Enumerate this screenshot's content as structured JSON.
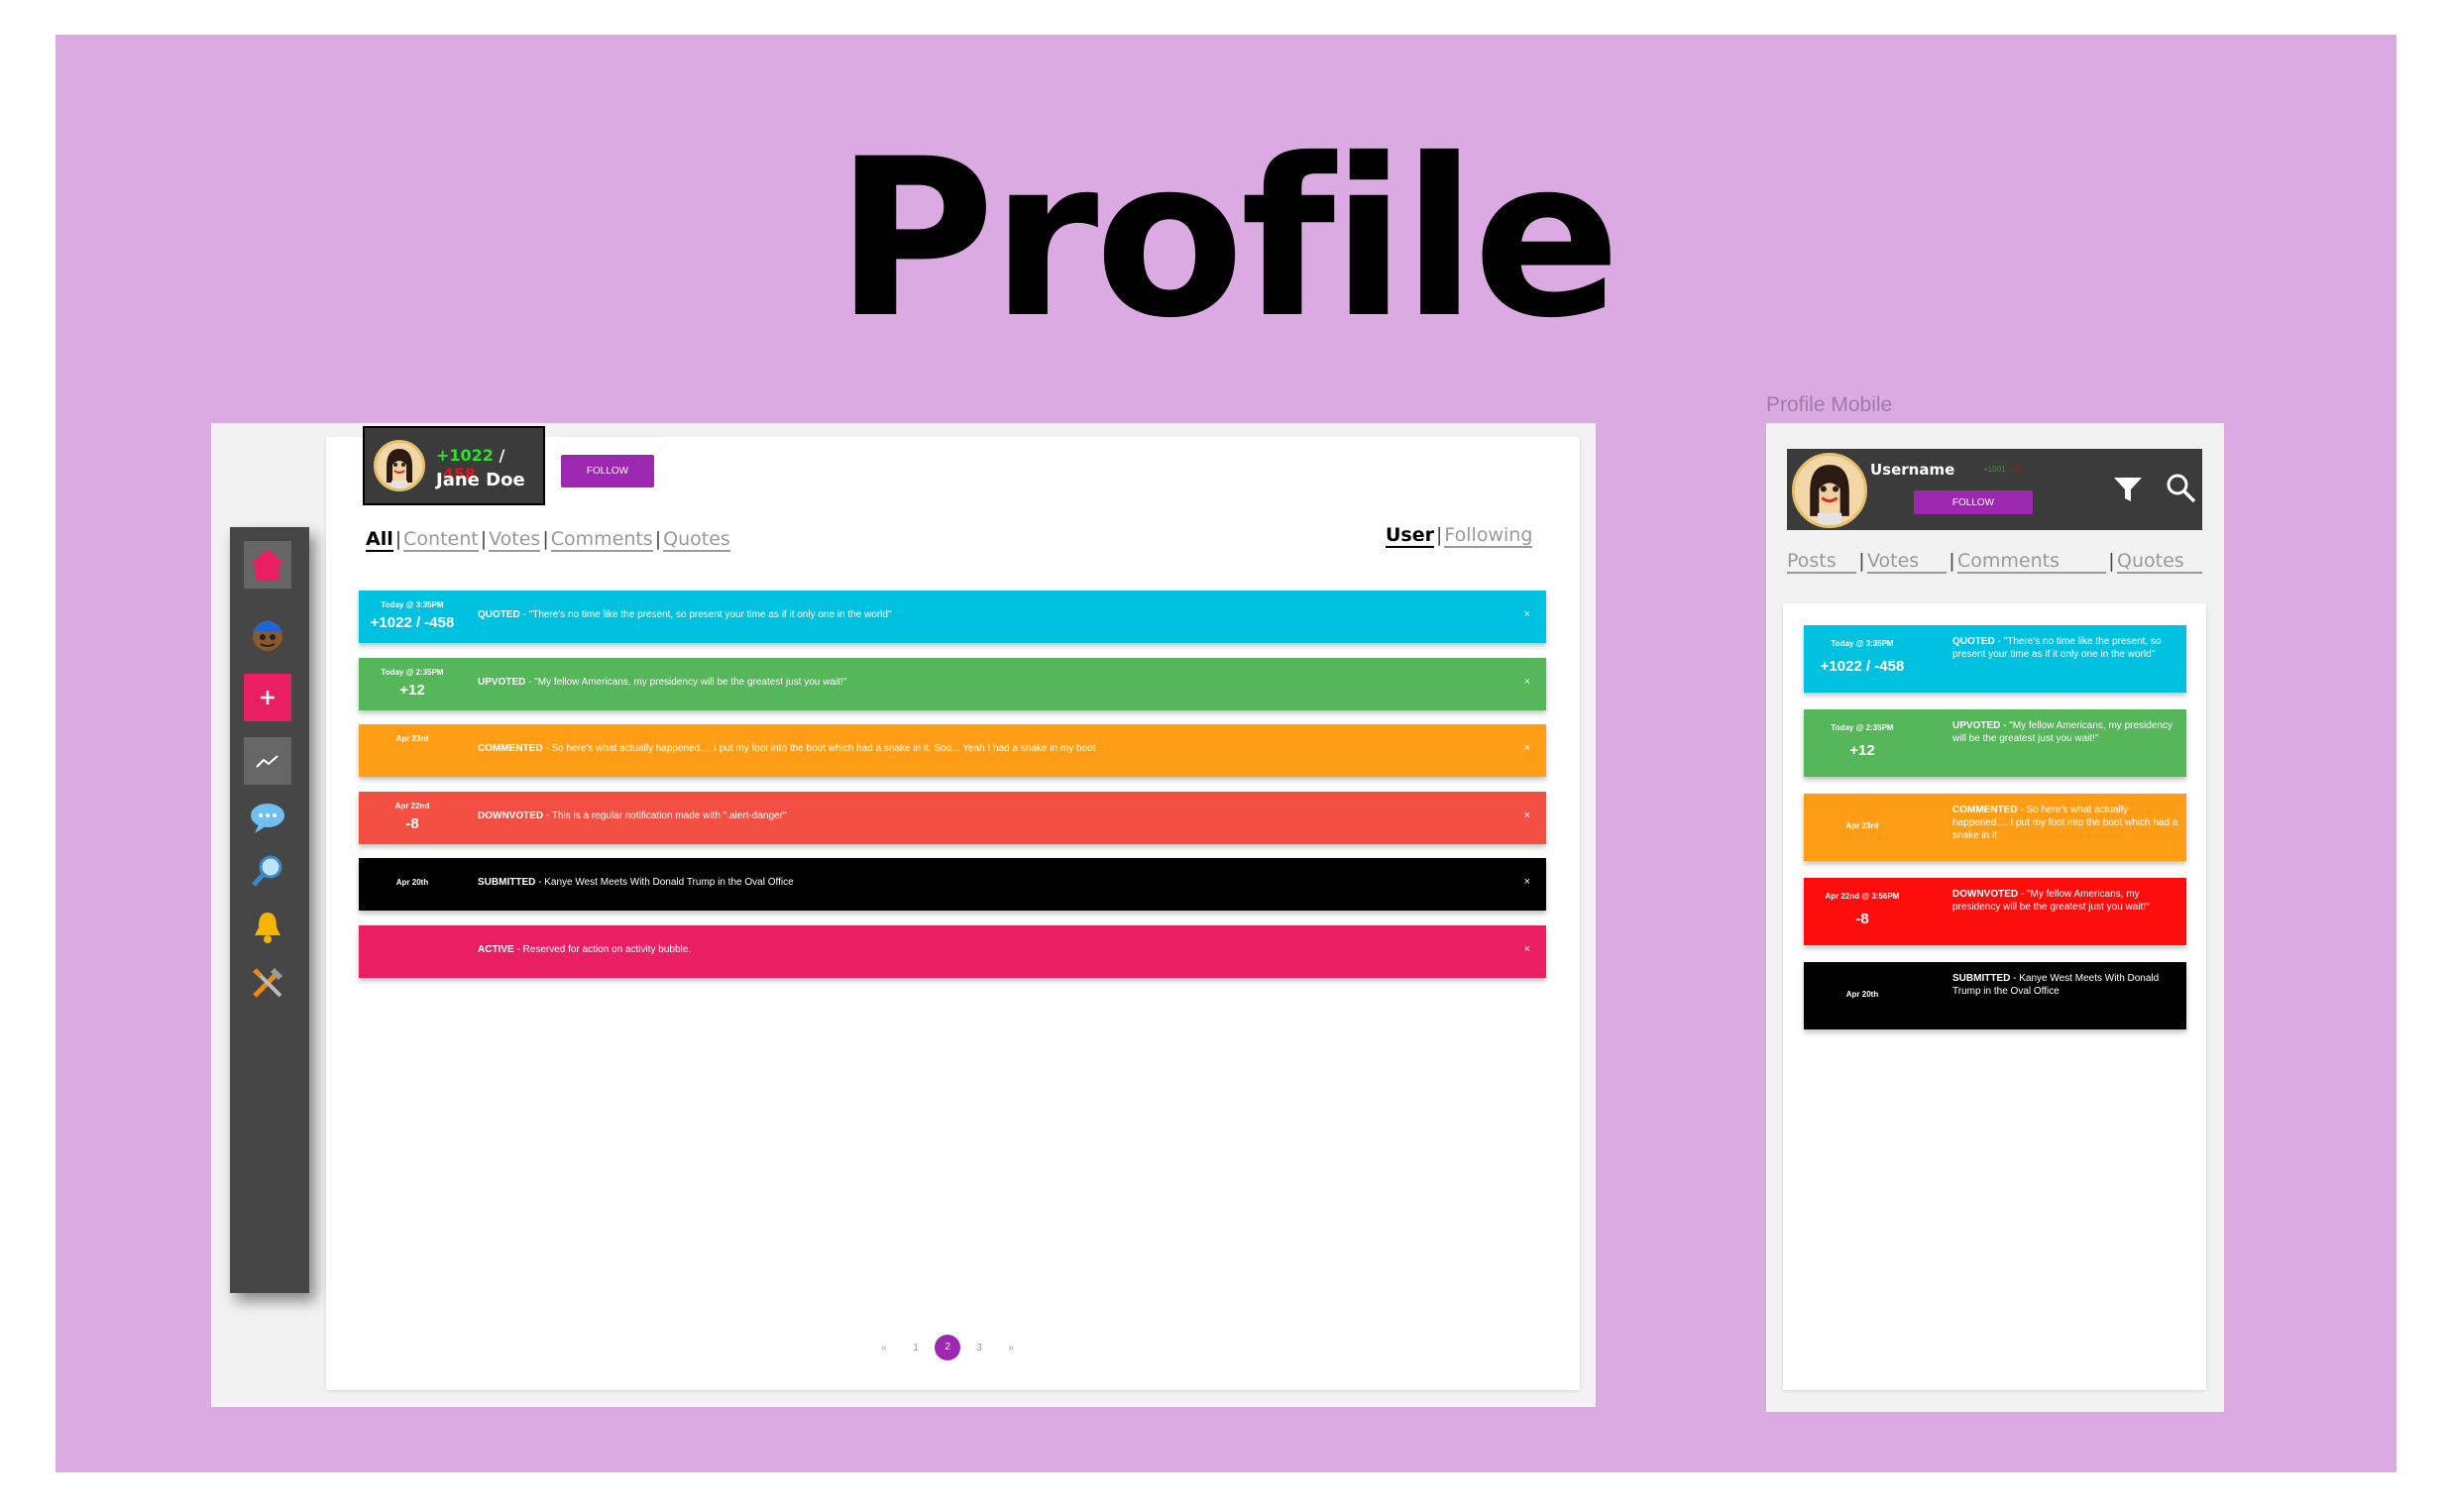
{
  "page_title": "Profile",
  "desktop": {
    "profile": {
      "name": "Jane Doe",
      "score_pos": "+1022",
      "score_neg": "-458",
      "slash": "/"
    },
    "follow_label": "FOLLOW",
    "tabs": {
      "all": "All",
      "content": "Content",
      "votes": "Votes",
      "comments": "Comments",
      "quotes": "Quotes",
      "sep": "|"
    },
    "view_tabs": {
      "user": "User",
      "following": "Following"
    },
    "alerts": [
      {
        "color": "#00c2e0",
        "date": "Today @ 3:35PM",
        "score": "+1022 / -458",
        "action": "QUOTED",
        "text": " - \"There's no time like the present, so present your time as if it only one in the world\"",
        "close": "×"
      },
      {
        "color": "#55b65a",
        "date": "Today @ 2:35PM",
        "score": "+12",
        "action": "UPVOTED",
        "text": " - \"My fellow Americans, my presidency will be the greatest just you wait!\"",
        "close": "×"
      },
      {
        "color": "#ff9e16",
        "date": "Apr 23rd",
        "score": "",
        "action": "COMMENTED",
        "text": " - So here's what actually happened.... I put my foot into the boot which had a snake in it. Soo... Yeah I had a snake in my boot",
        "close": "×"
      },
      {
        "color": "#f44f43",
        "date": "Apr 22nd",
        "score": "-8",
        "action": "DOWNVOTED",
        "text": " - This is a regular notification made with \".alert-danger\"",
        "close": "×"
      },
      {
        "color": "#000000",
        "date": "Apr 20th",
        "score": "",
        "action": "SUBMITTED",
        "text": " - Kanye West Meets With Donald Trump in the Oval Office",
        "close": "×"
      },
      {
        "color": "#e91e63",
        "date": "",
        "score": "",
        "action": "ACTIVE",
        "text": " - Reserved for action on activity bubble.",
        "close": "×"
      }
    ],
    "pagination": {
      "prev": "«",
      "pages": [
        "1",
        "2",
        "3"
      ],
      "current": "2",
      "next": "»"
    }
  },
  "mobile": {
    "label": "Profile Mobile",
    "username": "Username",
    "score_pos": "+1001",
    "score_neg": "-500",
    "follow_label": "FOLLOW",
    "tabs": {
      "posts": "Posts",
      "votes": "Votes",
      "comments": "Comments",
      "quotes": "Quotes",
      "sep": "|"
    },
    "alerts": [
      {
        "color": "#00c2e0",
        "date": "Today @ 3:35PM",
        "score": "+1022 / -458",
        "action": "QUOTED",
        "text": " - \"There's no time like the present, so present your time as if it only one in the world\""
      },
      {
        "color": "#55b65a",
        "date": "Today @ 2:35PM",
        "score": "+12",
        "action": "UPVOTED",
        "text": " - \"My fellow Americans, my presidency will be the greatest just you wait!\""
      },
      {
        "color": "#ff9e16",
        "date": "Apr 23rd",
        "score": "",
        "action": "COMMENTED",
        "text": " - So here's what actually happened.... I put my foot into the boot which had a snake in it"
      },
      {
        "color": "#ff0d0d",
        "date": "Apr 22nd @ 3:56PM",
        "score": "-8",
        "action": "DOWNVOTED",
        "text": " - \"My fellow Americans, my presidency will be the greatest just you wait!\""
      },
      {
        "color": "#000000",
        "date": "Apr 20th",
        "score": "",
        "action": "SUBMITTED",
        "text": " - Kanye West Meets With Donald Trump in the Oval Office"
      }
    ]
  },
  "sidebar_icons": [
    "home-icon",
    "user-avatar-icon",
    "add-icon",
    "trending-icon",
    "chat-icon",
    "search-icon",
    "bell-icon",
    "tools-icon"
  ]
}
